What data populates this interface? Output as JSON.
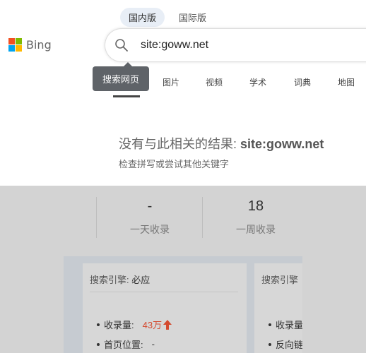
{
  "region_tabs": [
    "国内版",
    "国际版"
  ],
  "logo": {
    "text": "Bing",
    "colors": [
      "#f25022",
      "#7fba00",
      "#00a4ef",
      "#ffb900"
    ]
  },
  "search": {
    "value": "site:goww.net"
  },
  "tooltip": "搜索网页",
  "nav_tabs": [
    "图片",
    "视频",
    "学术",
    "词典",
    "地图"
  ],
  "no_result": {
    "prefix": "没有与此相关的结果: ",
    "query": "site:goww.net"
  },
  "hint": "检查拼写或尝试其他关键字",
  "stats": [
    {
      "value": "-",
      "label": "一天收录"
    },
    {
      "value": "18",
      "label": "一周收录"
    }
  ],
  "cards": [
    {
      "title_prefix": "搜索引擎: ",
      "title_engine": "必应",
      "rows": [
        {
          "label": "收录量:",
          "value": "43万"
        },
        {
          "label": "首页位置:",
          "value": "-"
        }
      ]
    },
    {
      "title_prefix": "搜索引擎",
      "rows": [
        {
          "label": "收录量"
        },
        {
          "label": "反向链"
        }
      ]
    }
  ],
  "accent_red": "#d44a2f"
}
